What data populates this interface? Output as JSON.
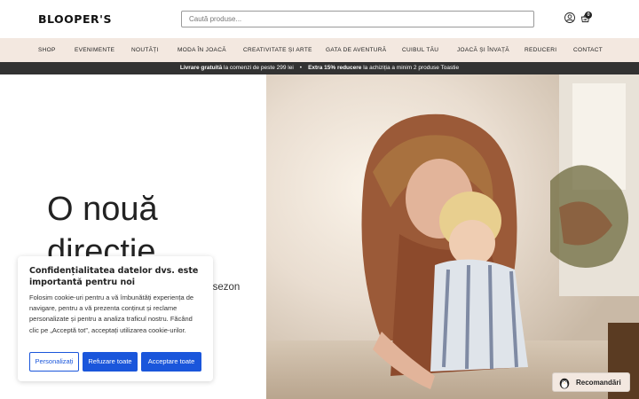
{
  "brand": {
    "logo": "BLOOPER'S"
  },
  "search": {
    "placeholder": "Caută produse..."
  },
  "cart": {
    "count": "0"
  },
  "nav": {
    "items": [
      "SHOP",
      "EVENIMENTE",
      "NOUTĂȚI",
      "MODA ÎN JOACĂ",
      "CREATIVITATE ȘI ARTE",
      "GATA DE AVENTURĂ",
      "CUIBUL TĂU",
      "JOACĂ ȘI ÎNVAȚĂ",
      "REDUCERI",
      "CONTACT"
    ]
  },
  "promo": {
    "part1_bold": "Livrare gratuită",
    "part1_rest": " la comenzi de peste 299 lei",
    "separator": "•",
    "part2_bold": "Extra 15% reducere",
    "part2_rest": " la achiziția a minim 2 produse Toastie"
  },
  "hero": {
    "title": "O nouă direcție",
    "subtitle": "n sezon"
  },
  "cookie": {
    "title": "Confidențialitatea datelor dvs. este importantă pentru noi",
    "text": "Folosim cookie-uri pentru a vă îmbunătăți experiența de navigare, pentru a vă prezenta conținut și reclame personalizate și pentru a analiza traficul nostru. Făcând clic pe „Acceptă tot”, acceptați utilizarea cookie-urilor.",
    "btn_customize": "Personalizați",
    "btn_reject": "Refuzare toate",
    "btn_accept": "Acceptare toate"
  },
  "recommend": {
    "label": "Recomandări"
  },
  "colors": {
    "nav_bg": "#f3e8e0",
    "promo_bg": "#323232",
    "accent_blue": "#1a56db"
  },
  "icons": [
    "user-icon",
    "cart-icon",
    "penguin-icon"
  ]
}
